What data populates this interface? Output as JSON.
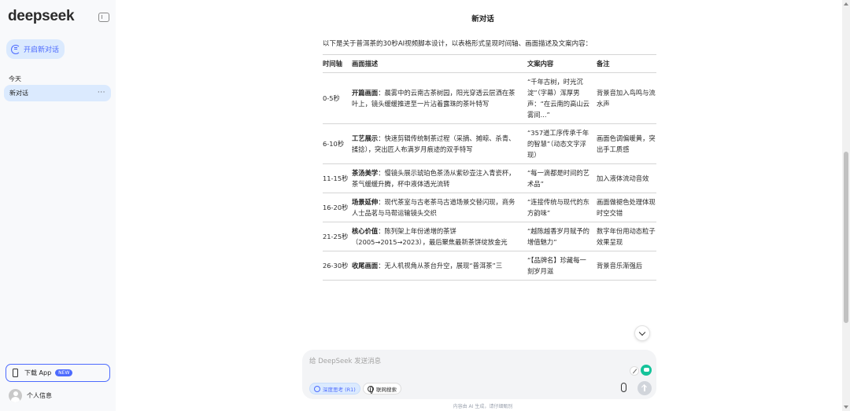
{
  "sidebar": {
    "logo": "deepseek",
    "new_chat_label": "开启新对话",
    "section_label": "今天",
    "history": [
      {
        "label": "新对话",
        "more": "···"
      }
    ],
    "download": {
      "label": "下载 App",
      "badge": "NEW"
    },
    "profile_label": "个人信息"
  },
  "header": {
    "title": "新对话"
  },
  "message": {
    "intro": "以下是关于普洱茶的30秒AI视频脚本设计，以表格形式呈现时间轴、画面描述及文案内容："
  },
  "table": {
    "headers": [
      "时间轴",
      "画面描述",
      "文案内容",
      "备注"
    ],
    "rows": [
      {
        "time": "0-5秒",
        "desc_title": "开篇画面",
        "desc": "：晨雾中的云南古茶树园，阳光穿透云层洒在茶叶上，镜头缓缓推进至一片沾着露珠的茶叶特写",
        "copy": "“千年古树，时光沉淀”（字幕）浑厚男声：“在云南的高山云雾间...”",
        "note": "背景音加入鸟鸣与流水声"
      },
      {
        "time": "6-10秒",
        "desc_title": "工艺展示",
        "desc": "：快速剪辑传统制茶过程（采摘、摊晾、杀青、揉捻），突出匠人布满岁月痕迹的双手特写",
        "copy": "“357道工序传承千年的智慧”（动态文字浮现）",
        "note": "画面色调偏暖黄，突出手工质感"
      },
      {
        "time": "11-15秒",
        "desc_title": "茶汤美学",
        "desc": "：慢镜头展示琥珀色茶汤从紫砂壶注入青瓷杯，茶气缓缓升腾，杯中液体透光流转",
        "copy": "“每一滴都是时间的艺术品”",
        "note": "加入液体流动音效"
      },
      {
        "time": "16-20秒",
        "desc_title": "场景延伸",
        "desc": "：现代茶室与古老茶马古道场景交替闪现，商务人士品茗与马帮运输镜头交织",
        "copy": "“连接传统与现代的东方韵味”",
        "note": "画面做褪色处理体现时空交错"
      },
      {
        "time": "21-25秒",
        "desc_title": "核心价值",
        "desc": "：陈列架上年份递增的茶饼（2005→2015→2023），最后聚焦最新茶饼绽放金光",
        "copy": "“越陈越香岁月赋予的增值魅力”",
        "note": "数字年份用动态粒子效果呈现"
      },
      {
        "time": "26-30秒",
        "desc_title": "收尾画面",
        "desc": "：无人机视角从茶台升空，展现“普洱茶”三",
        "copy": "“【品牌名】珍藏每一刻岁月滋",
        "note": "背景音乐渐强后"
      }
    ]
  },
  "composer": {
    "placeholder": "给 DeepSeek 发送消息",
    "deep_think_label": "深度思考 (R1)",
    "web_search_label": "联网搜索"
  },
  "footer_note": "内容由 AI 生成，请仔细甄别",
  "colors": {
    "accent": "#4d6bfe",
    "sidebar_bg": "#f8f9fb",
    "selected_bg": "#dbeafe"
  }
}
